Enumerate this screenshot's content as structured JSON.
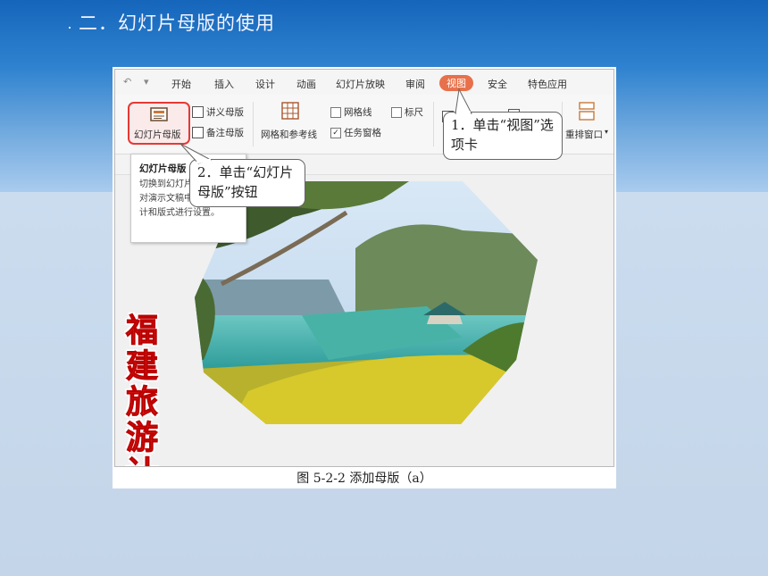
{
  "slide": {
    "title": "二．幻灯片母版的使用"
  },
  "ribbon": {
    "quick_access": [
      "↶",
      "▾"
    ],
    "tabs": [
      "开始",
      "插入",
      "设计",
      "动画",
      "幻灯片放映",
      "审阅",
      "视图",
      "安全",
      "特色应用"
    ],
    "active_tab": "视图",
    "slide_master_label": "幻灯片母版",
    "handout_master_label": "讲义母版",
    "notes_master_label": "备注母版",
    "grid_guides_label": "网格和参考线",
    "gridlines_label": "网格线",
    "ruler_label": "标尺",
    "task_pane_label": "任务窗格",
    "rearrange_window_label": "重排窗口",
    "colors": {
      "active_tab": "#e8704a",
      "highlight": "#e53935"
    }
  },
  "tooltip": {
    "title": "幻灯片母版",
    "body": "切换到幻灯片母版视图，对演示文稿中幻灯片的设计和版式进行设置。"
  },
  "callouts": {
    "step1": "1．单击“视图”选项卡",
    "step2": "2．单击“幻灯片母版”按钮"
  },
  "slide_preview": {
    "vertical_title": "福建旅游计划书"
  },
  "figure": {
    "caption": "图 5-2-2 添加母版（a）"
  }
}
